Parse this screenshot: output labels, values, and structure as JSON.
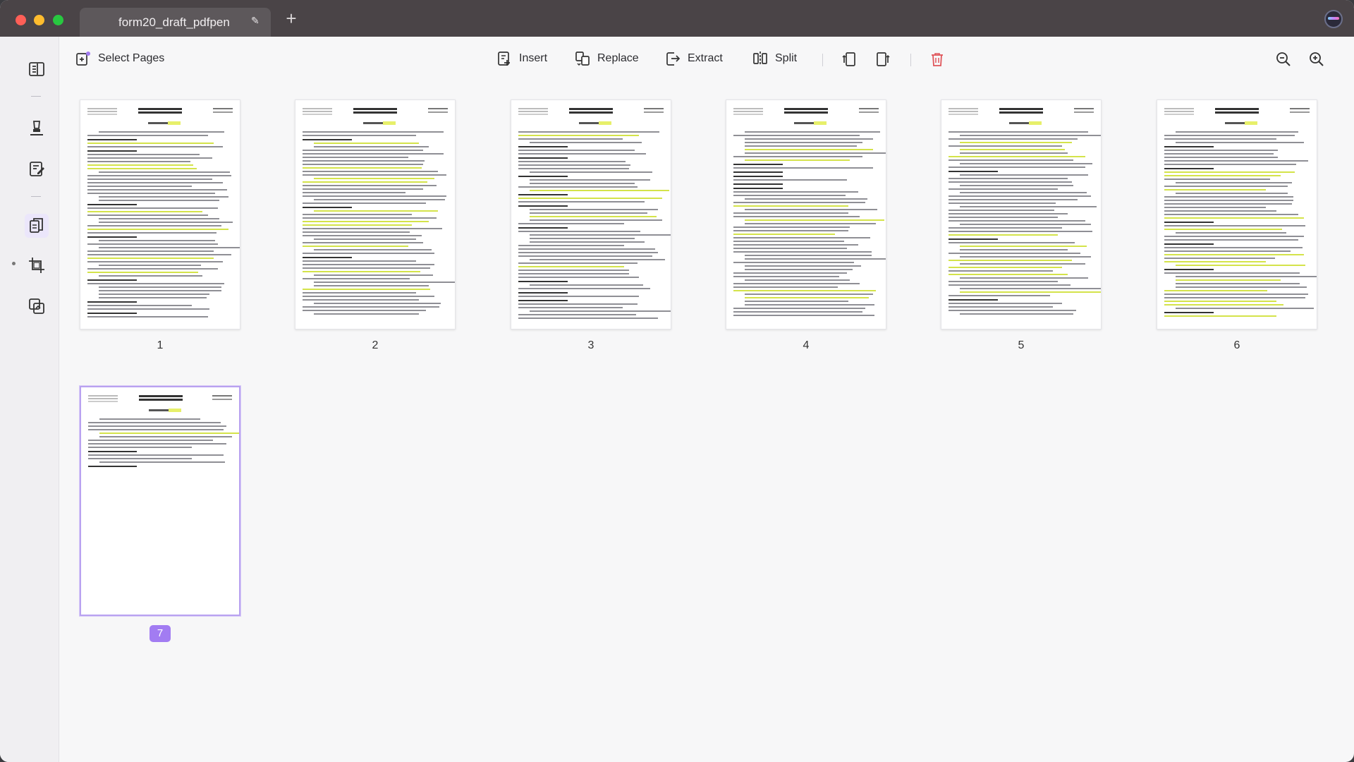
{
  "tab": {
    "title": "form20_draft_pdfpen"
  },
  "toolbar": {
    "select_pages": "Select Pages",
    "insert": "Insert",
    "replace": "Replace",
    "extract": "Extract",
    "split": "Split"
  },
  "pages": [
    {
      "number": "1",
      "selected": false
    },
    {
      "number": "2",
      "selected": false
    },
    {
      "number": "3",
      "selected": false
    },
    {
      "number": "4",
      "selected": false
    },
    {
      "number": "5",
      "selected": false
    },
    {
      "number": "6",
      "selected": false
    },
    {
      "number": "7",
      "selected": true
    }
  ],
  "colors": {
    "accent": "#a27cf2",
    "delete": "#e0555a",
    "highlight": "#d4e34a"
  },
  "icons": {
    "sidebar": [
      "reader-icon",
      "highlighter-icon",
      "edit-document-icon",
      "organize-pages-icon",
      "crop-icon",
      "combine-pages-icon"
    ],
    "toolbar": [
      "select-pages-icon",
      "insert-icon",
      "replace-icon",
      "extract-icon",
      "split-icon",
      "rotate-left-icon",
      "rotate-right-icon",
      "delete-icon",
      "zoom-out-icon",
      "zoom-in-icon"
    ]
  }
}
